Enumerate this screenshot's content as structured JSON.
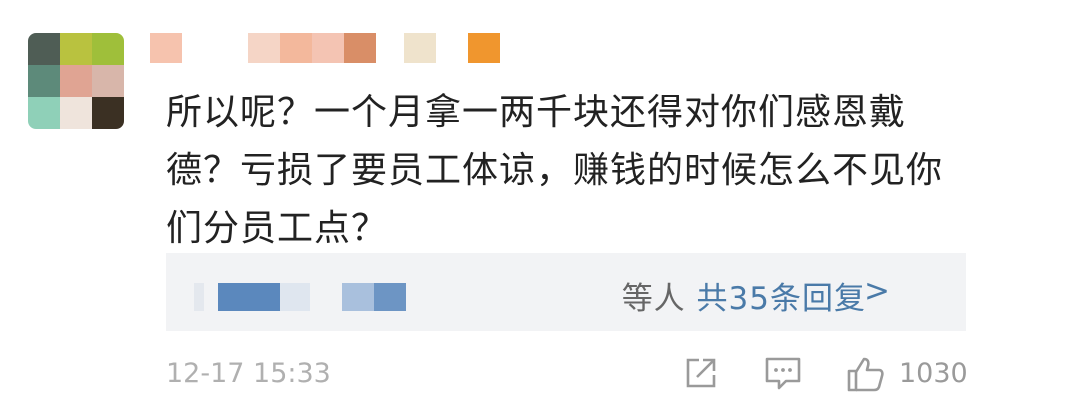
{
  "comment": {
    "lines": [
      "所以呢？一个月拿一两千块还得对你们感恩戴",
      "德？亏损了要员工体谅，赚钱的时候怎么不见你",
      "们分员工点？"
    ]
  },
  "replies": {
    "suffix": "等人",
    "count_label": "共35条回复",
    "chevron": ">"
  },
  "footer": {
    "time": "12-17 15:33",
    "likes": "1030"
  },
  "icons": {
    "share": "share-icon",
    "comment": "comment-icon",
    "like": "thumbs-up-icon"
  },
  "colors": {
    "text": "#222222",
    "link": "#4a7aa8",
    "muted": "#b0b0b0",
    "reply_bg": "#f2f3f5"
  }
}
